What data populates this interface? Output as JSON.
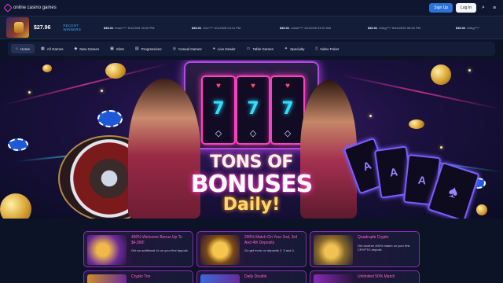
{
  "header": {
    "logo_text": "online casino games",
    "signup_label": "Sign Up",
    "login_label": "Log In"
  },
  "winners": {
    "jackpot_amount": "$27.96",
    "recent_label": "RECENT WINNERS",
    "items": [
      {
        "amount": "$30.01",
        "who": "Evan**** 5/1/2026 09:05 PM"
      },
      {
        "amount": "$30.01",
        "who": "JDo**** 5/1/2026 04:11 PM"
      },
      {
        "amount": "$30.01",
        "who": "mshe**** 5/1/2026 03:07 AM"
      },
      {
        "amount": "$30.01",
        "who": "Ddkg**** 5/31/2026 08:52 PM"
      },
      {
        "amount": "$30.02",
        "who": "Ddkg****"
      }
    ]
  },
  "nav": {
    "items": [
      {
        "label": "Home",
        "icon": "home-icon",
        "glyph": "⌂"
      },
      {
        "label": "All Games",
        "icon": "grid-icon",
        "glyph": "▦"
      },
      {
        "label": "New Games",
        "icon": "diamond-icon",
        "glyph": "◆"
      },
      {
        "label": "Slots",
        "icon": "slot-icon",
        "glyph": "▣"
      },
      {
        "label": "Progressives",
        "icon": "chart-icon",
        "glyph": "▤"
      },
      {
        "label": "Casual Games",
        "icon": "gamepad-icon",
        "glyph": "◎"
      },
      {
        "label": "Live Dealer",
        "icon": "camera-icon",
        "glyph": "●"
      },
      {
        "label": "Table Games",
        "icon": "table-icon",
        "glyph": "▭"
      },
      {
        "label": "Specialty",
        "icon": "star-icon",
        "glyph": "✦"
      },
      {
        "label": "Video Poker",
        "icon": "cards-icon",
        "glyph": "▯"
      }
    ]
  },
  "banner": {
    "line1": "TONS OF",
    "line2": "BONUSES",
    "line3": "Daily!"
  },
  "promos": [
    {
      "title": "400% Welcome Bonus Up To $4,000!",
      "desc": "Get an additional 4x on your first deposit."
    },
    {
      "title": "200% Match On Your 2nd, 3rd And 4th Deposits",
      "desc": "Go get more on deposits 2, 3 and 4."
    },
    {
      "title": "Quadruple Crypto",
      "desc": "Get another 400% match on your first CRYPTO deposit."
    },
    {
      "title": "Crypto Trio",
      "desc": ""
    },
    {
      "title": "Daily Double",
      "desc": ""
    },
    {
      "title": "Unlimited 50% Match",
      "desc": ""
    }
  ],
  "colors": {
    "accent_pink": "#ff63c9",
    "accent_blue": "#3aa4f2",
    "signup_blue": "#2b73d6"
  }
}
